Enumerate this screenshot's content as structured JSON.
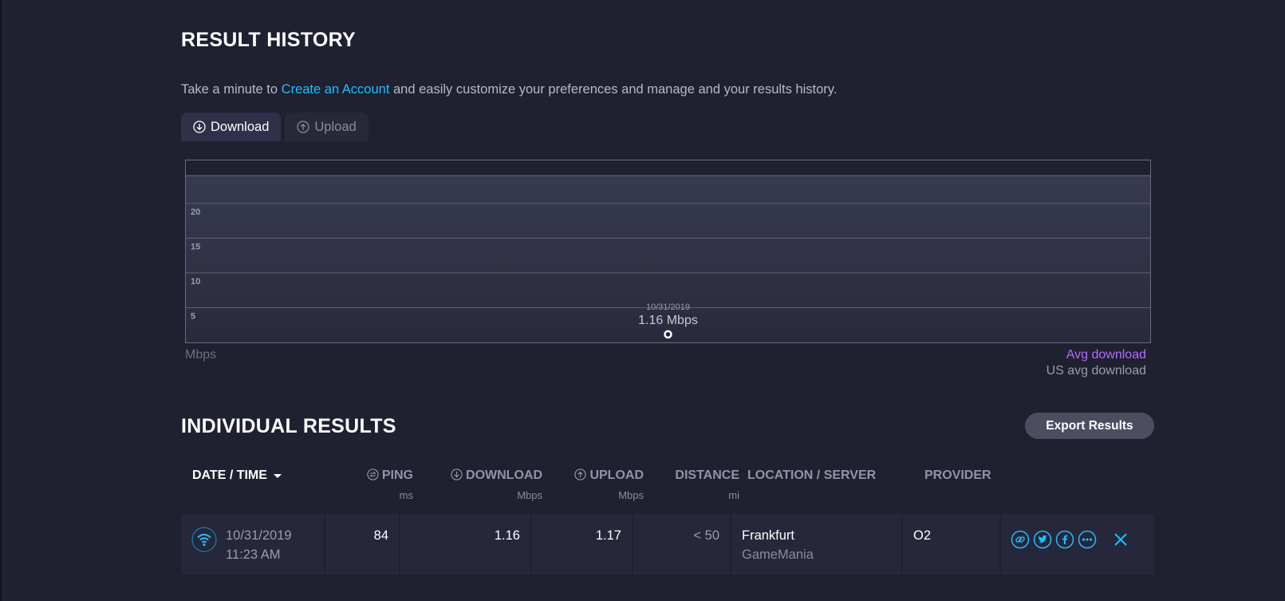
{
  "history": {
    "title": "RESULT HISTORY",
    "intro_before": "Take a minute to ",
    "intro_link": "Create an Account",
    "intro_after": " and easily customize your preferences and manage and your results history.",
    "tabs": [
      {
        "label": "Download",
        "icon": "download-arrow-icon",
        "active": true
      },
      {
        "label": "Upload",
        "icon": "upload-arrow-icon",
        "active": false
      }
    ],
    "unit": "Mbps",
    "legend": {
      "avg": "Avg download",
      "us_avg": "US avg download"
    },
    "legend_colors": {
      "avg": "#b36cff",
      "us_avg": "#9a9bab"
    }
  },
  "chart_data": {
    "type": "scatter",
    "x": [
      "10/31/2019"
    ],
    "series": [
      {
        "values": [
          1.16
        ]
      }
    ],
    "point_labels": [
      {
        "date": "10/31/2019",
        "value": "1.16 Mbps"
      }
    ],
    "yticks": [
      5,
      10,
      15,
      20
    ],
    "ylim": [
      0,
      24
    ],
    "ylabel": "Mbps",
    "grid": true
  },
  "results": {
    "title": "INDIVIDUAL RESULTS",
    "export_label": "Export Results",
    "columns": {
      "date": {
        "label": "DATE / TIME"
      },
      "ping": {
        "label": "PING",
        "unit": "ms",
        "icon": "ping-icon"
      },
      "download": {
        "label": "DOWNLOAD",
        "unit": "Mbps",
        "icon": "download-arrow-icon"
      },
      "upload": {
        "label": "UPLOAD",
        "unit": "Mbps",
        "icon": "upload-arrow-icon"
      },
      "distance": {
        "label": "DISTANCE",
        "unit": "mi"
      },
      "location": {
        "label": "LOCATION / SERVER"
      },
      "provider": {
        "label": "PROVIDER"
      }
    },
    "rows": [
      {
        "connection_icon": "wifi-icon",
        "date": "10/31/2019",
        "time": "11:23 AM",
        "ping": "84",
        "download": "1.16",
        "upload": "1.17",
        "distance": "< 50",
        "location": "Frankfurt",
        "server": "GameMania",
        "provider": "O2"
      }
    ],
    "accent_color": "#1cbfff"
  }
}
